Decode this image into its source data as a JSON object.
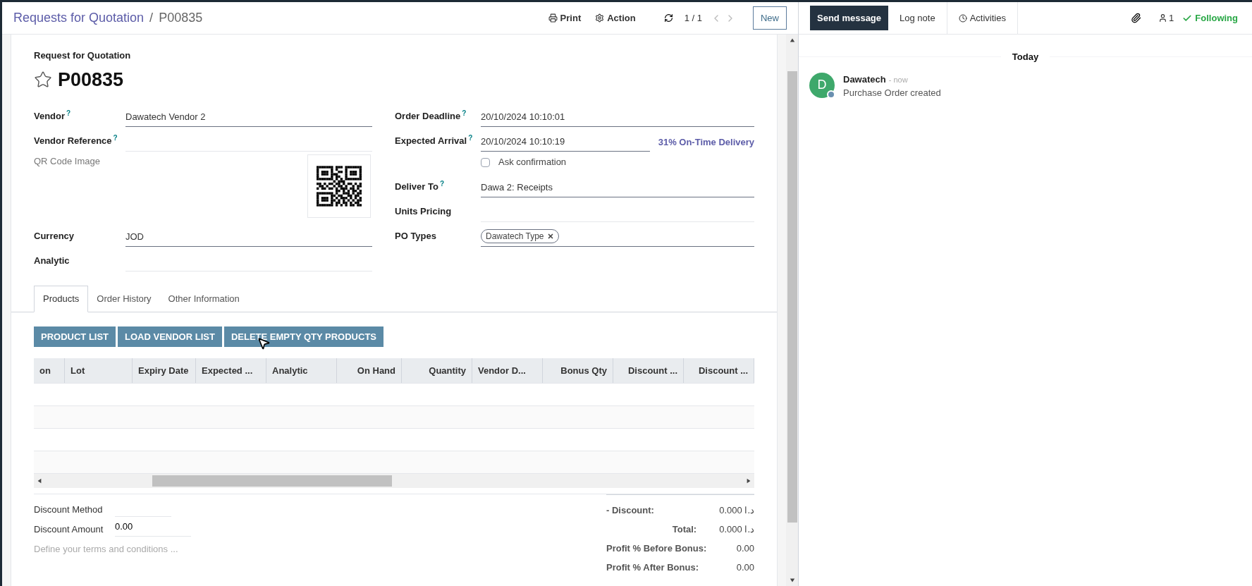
{
  "breadcrumb": {
    "parent": "Requests for Quotation",
    "separator": "/",
    "current": "P00835"
  },
  "toolbar": {
    "print": "Print",
    "action": "Action",
    "pager": "1 / 1",
    "new": "New"
  },
  "chatter": {
    "send": "Send message",
    "log": "Log note",
    "activities": "Activities",
    "followers": "1",
    "following": "Following",
    "date": "Today",
    "messages": [
      {
        "initial": "D",
        "author": "Dawatech",
        "time": "- now",
        "body": "Purchase Order created"
      }
    ]
  },
  "form": {
    "type": "Request for Quotation",
    "name": "P00835",
    "starred": false,
    "left": [
      {
        "kind": "field",
        "label": "Vendor",
        "help": "?",
        "value": "Dawatech Vendor 2"
      },
      {
        "kind": "field",
        "label": "Vendor Reference",
        "help": "?"
      },
      {
        "kind": "qr",
        "label": "QR Code Image"
      },
      {
        "kind": "field",
        "label": "Currency",
        "value": "JOD"
      },
      {
        "kind": "field",
        "label": "Analytic"
      }
    ],
    "right": [
      {
        "kind": "field",
        "label": "Order Deadline",
        "help": "?",
        "value": "20/10/2024 10:10:01"
      },
      {
        "kind": "field",
        "label": "Expected Arrival",
        "help": "?",
        "value": "20/10/2024 10:10:19",
        "extra": "31% On-Time Delivery"
      },
      {
        "kind": "check",
        "label": "Ask confirmation",
        "checked": false
      },
      {
        "kind": "field",
        "label": "Deliver To",
        "help": "?",
        "value": "Dawa 2: Receipts"
      },
      {
        "kind": "field",
        "label": "Units Pricing"
      },
      {
        "kind": "tags",
        "label": "PO Types",
        "tags": [
          "Dawatech Type"
        ]
      }
    ]
  },
  "tabs": [
    {
      "label": "Products",
      "selected": true
    },
    {
      "label": "Order History",
      "selected": false
    },
    {
      "label": "Other Information",
      "selected": false
    }
  ],
  "buttons": [
    "PRODUCT LIST",
    "LOAD VENDOR LIST",
    "DELETE EMPTY QTY PRODUCTS"
  ],
  "table": {
    "columns": [
      {
        "label": "on",
        "kind": "text"
      },
      {
        "label": "Lot",
        "kind": "text"
      },
      {
        "label": "Expiry Date",
        "kind": "text"
      },
      {
        "label": "Expected ...",
        "kind": "text"
      },
      {
        "label": "Analytic",
        "kind": "text"
      },
      {
        "label": "On Hand",
        "kind": "number"
      },
      {
        "label": "Quantity",
        "kind": "number"
      },
      {
        "label": "Vendor D...",
        "kind": "text"
      },
      {
        "label": "Bonus Qty",
        "kind": "number"
      },
      {
        "label": "Discount ...",
        "kind": "number"
      },
      {
        "label": "Discount ...",
        "kind": "number"
      }
    ]
  },
  "footer": {
    "fields": [
      {
        "label": "Discount Method"
      },
      {
        "label": "Discount Amount",
        "value": "0.00"
      }
    ],
    "terms_placeholder": "Define your terms and conditions ...",
    "totals": [
      {
        "label": "- Discount:",
        "value": "0.000",
        "currency": "د.ا"
      },
      {
        "label": "Total:",
        "value": "0.000",
        "currency": "د.ا"
      },
      {
        "label": "Profit % Before Bonus:",
        "value": "0.00"
      },
      {
        "label": "Profit % After Bonus:",
        "value": "0.00"
      }
    ]
  }
}
